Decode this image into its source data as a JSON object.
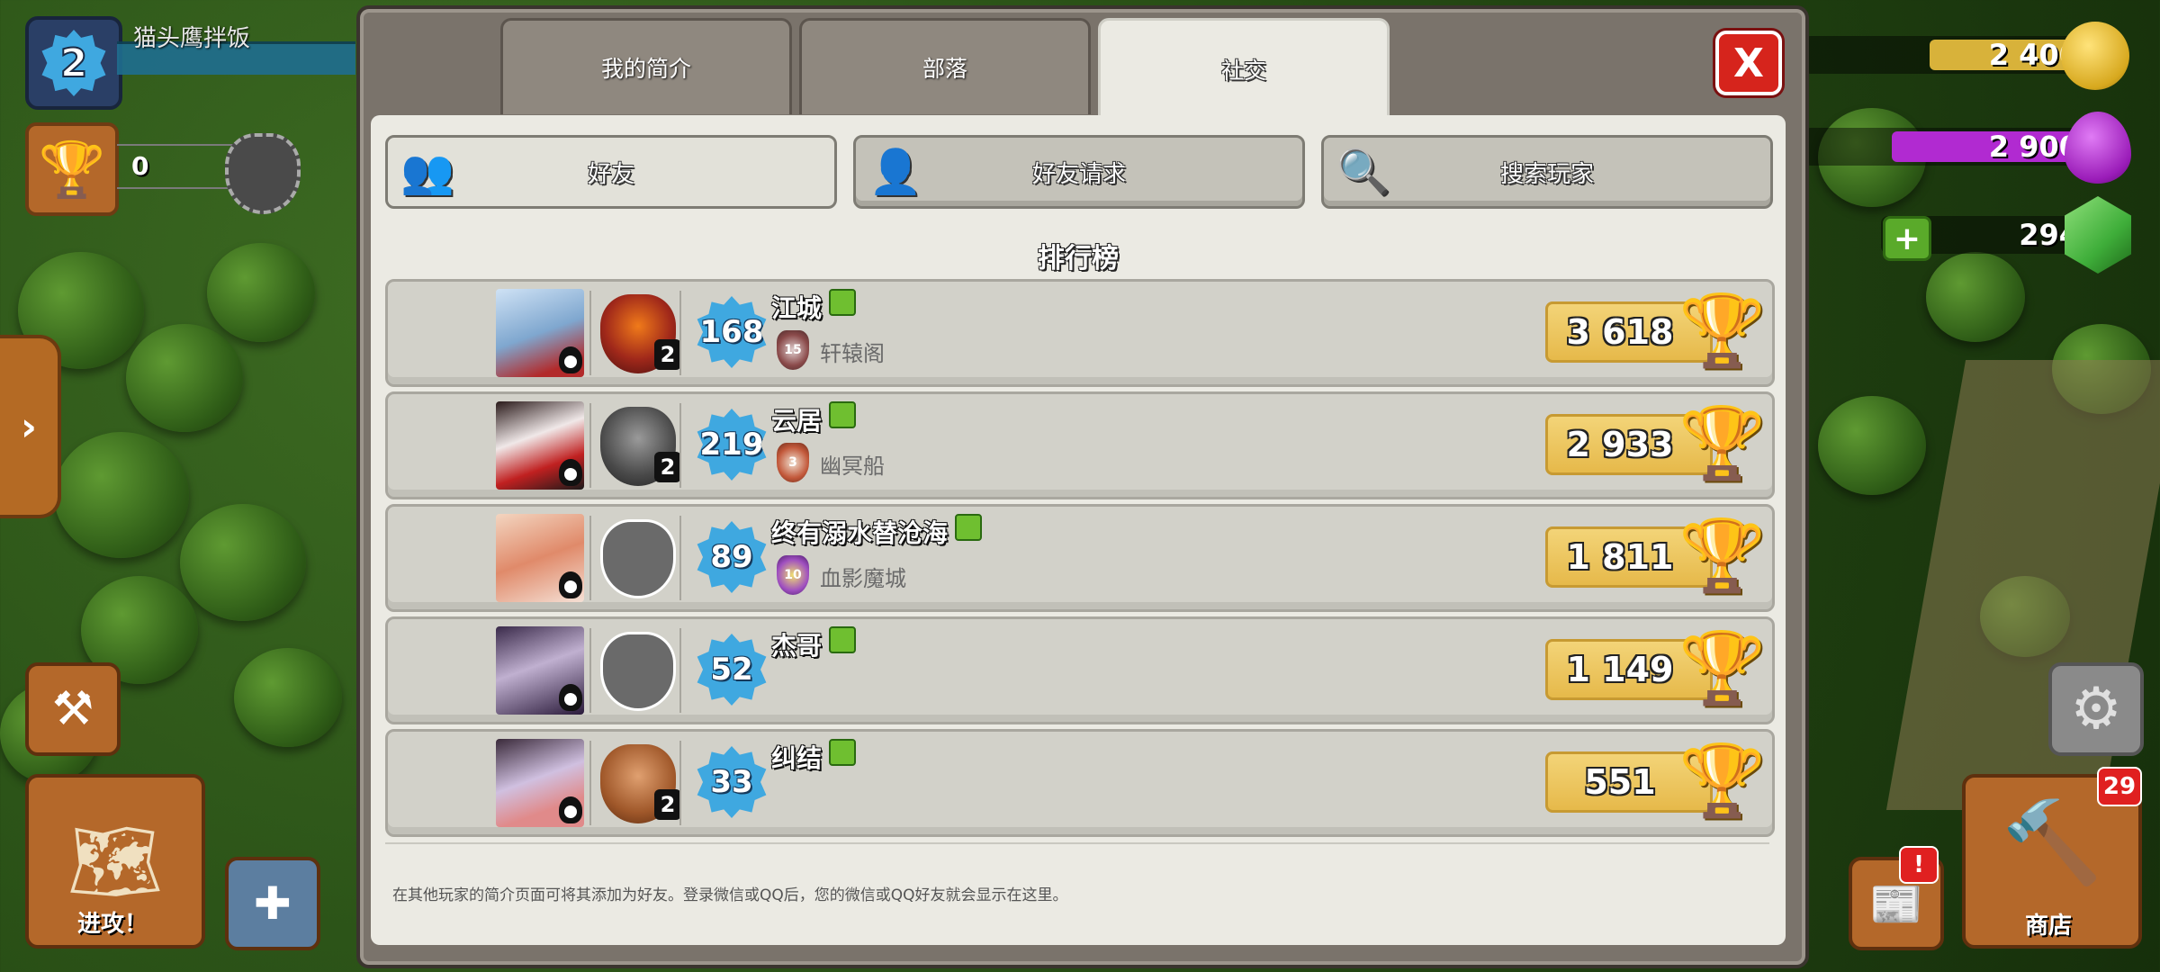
{
  "hud": {
    "level": "2",
    "player_name": "猫头鹰拌饭",
    "trophies": "0",
    "attack_label": "进攻！",
    "side_arrow": "›",
    "resources": {
      "gold": "2 400",
      "elixir": "2 900",
      "gems": "294"
    },
    "shop_label": "商店",
    "shop_badge": "29",
    "news_badge": "!",
    "colors": {
      "gold": "#e8c23a",
      "elixir": "#b12ad1",
      "gems": "#3fae3a"
    }
  },
  "modal": {
    "tabs": [
      {
        "label": "我的简介",
        "active": false
      },
      {
        "label": "部落",
        "active": false
      },
      {
        "label": "社交",
        "active": true
      }
    ],
    "close_label": "X",
    "sub_buttons": [
      {
        "label": "好友",
        "icon": "friends-icon",
        "active": true
      },
      {
        "label": "好友请求",
        "icon": "add-friend-icon",
        "active": false
      },
      {
        "label": "搜索玩家",
        "icon": "search-player-icon",
        "active": false
      }
    ],
    "section_title": "排行榜",
    "players": [
      {
        "name": "江城",
        "xp_level": "168",
        "clan": "轩辕阁",
        "clan_level": "15",
        "league_num": "2",
        "trophies": "3 618"
      },
      {
        "name": "云居",
        "xp_level": "219",
        "clan": "幽冥船",
        "clan_level": "3",
        "league_num": "2",
        "trophies": "2 933"
      },
      {
        "name": "终有溺水替沧海",
        "xp_level": "89",
        "clan": "血影魔城",
        "clan_level": "10",
        "league_num": "",
        "trophies": "1 811"
      },
      {
        "name": "杰哥",
        "xp_level": "52",
        "clan": "",
        "clan_level": "",
        "league_num": "",
        "trophies": "1 149"
      },
      {
        "name": "纠结",
        "xp_level": "33",
        "clan": "",
        "clan_level": "",
        "league_num": "2",
        "trophies": "551"
      }
    ],
    "footer_note": "在其他玩家的简介页面可将其添加为好友。登录微信或QQ后，您的微信或QQ好友就会显示在这里。"
  }
}
